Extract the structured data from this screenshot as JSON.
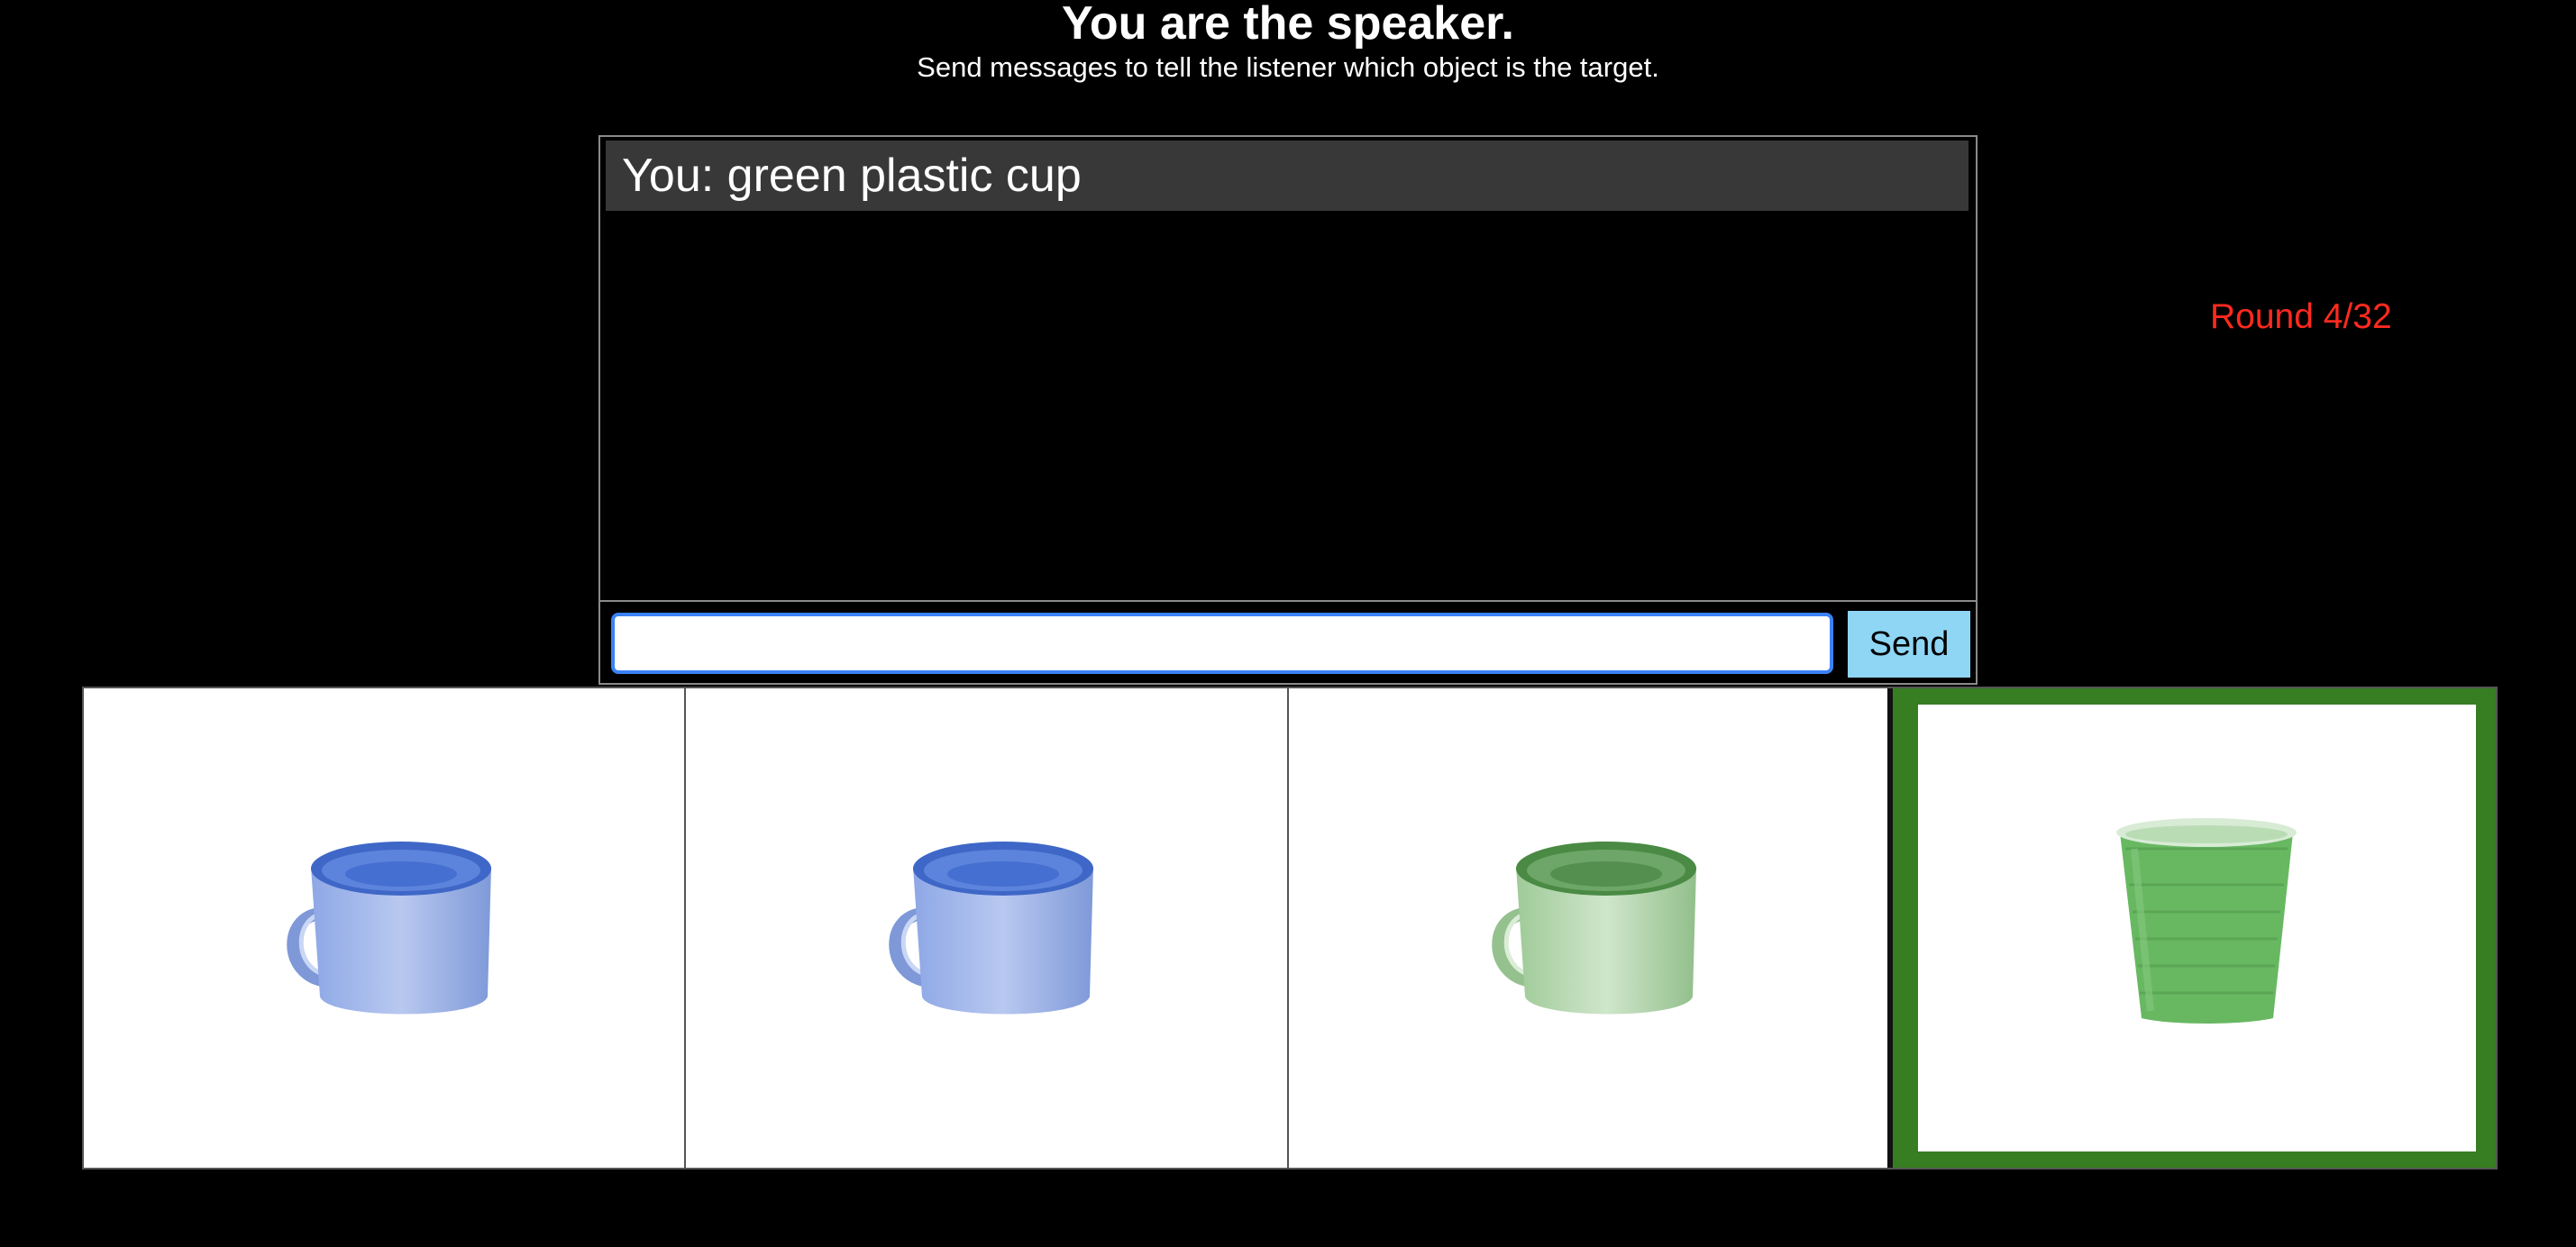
{
  "header": {
    "title": "You are the speaker.",
    "subtitle": "Send messages to tell the listener which object is the target."
  },
  "chat": {
    "messages": [
      {
        "text": "You: green plastic cup"
      }
    ],
    "input_value": "",
    "input_placeholder": "",
    "send_label": "Send"
  },
  "round": {
    "label": "Round 4/32"
  },
  "objects": [
    {
      "name": "blue metal cup",
      "icon": "blue-metal-mug-icon",
      "color": "#6e8fd8",
      "is_target": false
    },
    {
      "name": "blue metal cup",
      "icon": "blue-metal-mug-icon",
      "color": "#6e8fd8",
      "is_target": false
    },
    {
      "name": "green metal cup",
      "icon": "green-metal-mug-icon",
      "color": "#8fc48a",
      "is_target": false
    },
    {
      "name": "green plastic cup",
      "icon": "green-plastic-cup-icon",
      "color": "#6bb865",
      "is_target": true
    }
  ],
  "colors": {
    "background": "#000000",
    "target_border": "#377d22",
    "round_text": "#ff2a1f",
    "send_button": "#8fd6f5"
  }
}
